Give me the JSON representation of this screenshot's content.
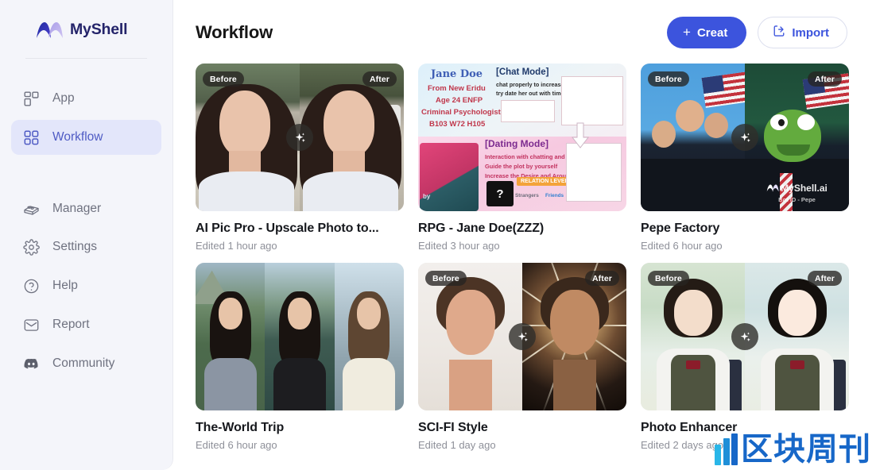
{
  "brand": {
    "name": "MyShell",
    "logo_icon": "myshell-wave-logo"
  },
  "sidebar": {
    "primary_items": [
      {
        "label": "App",
        "icon": "app-grid-icon",
        "active": false
      },
      {
        "label": "Workflow",
        "icon": "workflow-grid-icon",
        "active": true
      }
    ],
    "secondary_items": [
      {
        "label": "Manager",
        "icon": "lego-brick-icon"
      },
      {
        "label": "Settings",
        "icon": "gear-icon"
      },
      {
        "label": "Help",
        "icon": "question-circle-icon"
      },
      {
        "label": "Report",
        "icon": "envelope-icon"
      },
      {
        "label": "Community",
        "icon": "discord-icon"
      }
    ]
  },
  "header": {
    "title": "Workflow",
    "create_label": "Creat",
    "create_plus": "+",
    "create_icon": "plus-icon",
    "create_color": "#3c54dd",
    "import_label": "Import",
    "import_icon": "import-upload-icon"
  },
  "badges": {
    "before": "Before",
    "after": "After",
    "sparkle_icon": "sparkle-icon"
  },
  "cards": [
    {
      "title": "AI Pic Pro - Upscale Photo to...",
      "meta": "Edited 1 hour ago",
      "thumb_type": "before-after",
      "has_sparkle": true
    },
    {
      "title": "RPG - Jane Doe(ZZZ)",
      "meta": "Edited 3 hour ago",
      "thumb_type": "collage",
      "has_sparkle": false,
      "thumb_text": {
        "name": "Jane Doe",
        "origin": "From New Eridu",
        "age": "Age 24 ENFP",
        "job": "Criminal Psychologist",
        "stats": "B103 W72 H105",
        "chat_mode": "[Chat Mode]",
        "chat_line1": "chat properly to increase relations",
        "chat_line2": "try date her out with time and place",
        "dating_mode": "[Dating Mode]",
        "dating_line1": "Interaction with chatting and parentheses",
        "dating_line2": "Guide the plot by yourself",
        "dating_line3": "Increase the Desire and Arousal ...",
        "level_up": "RELATION LEVEL UP!",
        "strangers": "Strangers",
        "friends": "Friends",
        "by_line": "by",
        "question": "?"
      }
    },
    {
      "title": "Pepe Factory",
      "meta": "Edited 6 hour ago",
      "thumb_type": "before-after",
      "has_sparkle": true,
      "thumb_text": {
        "watermark": "MyShell.ai",
        "bot_id": "Bot ID - Pepe"
      }
    },
    {
      "title": "The-World Trip",
      "meta": "Edited 6 hour ago",
      "thumb_type": "triptych",
      "has_sparkle": false
    },
    {
      "title": "SCI-FI Style",
      "meta": "Edited 1 day ago",
      "thumb_type": "before-after",
      "has_sparkle": true
    },
    {
      "title": "Photo Enhancer",
      "meta": "Edited 2 days ago",
      "thumb_type": "before-after",
      "has_sparkle": true
    }
  ],
  "watermark": {
    "text": "区块周刊",
    "color": "#1767c8",
    "logo_icon": "blue-bars-logo"
  }
}
